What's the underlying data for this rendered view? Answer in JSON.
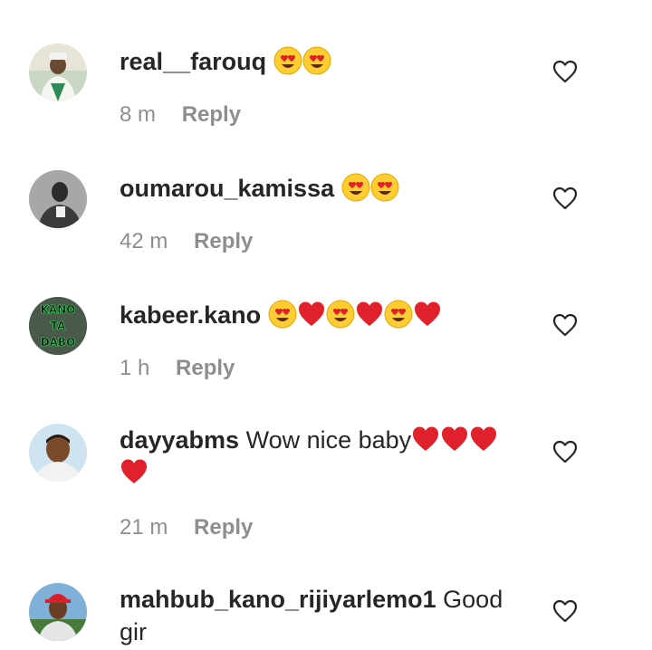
{
  "comments": [
    {
      "username": "real__farouq",
      "text": "",
      "emoji": [
        "heart-eyes",
        "heart-eyes"
      ],
      "time": "8 m",
      "reply_label": "Reply",
      "avatar": "avatar-photo-man-white-cap"
    },
    {
      "username": "oumarou_kamissa",
      "text": "",
      "emoji": [
        "heart-eyes",
        "heart-eyes"
      ],
      "time": "42 m",
      "reply_label": "Reply",
      "avatar": "avatar-photo-man-gray"
    },
    {
      "username": "kabeer.kano",
      "text": "",
      "emoji": [
        "heart-eyes",
        "red-heart",
        "heart-eyes",
        "red-heart",
        "heart-eyes",
        "red-heart"
      ],
      "time": "1 h",
      "reply_label": "Reply",
      "avatar": "avatar-kano-ta-dabo-logo",
      "avatar_text": [
        "KANO",
        "TA",
        "DABO"
      ]
    },
    {
      "username": "dayyabms",
      "text": "Wow nice baby",
      "emoji": [
        "red-heart",
        "red-heart",
        "red-heart",
        "red-heart"
      ],
      "time": "21 m",
      "reply_label": "Reply",
      "avatar": "avatar-photo-man-smiling"
    },
    {
      "username": "mahbub_kano_rijiyarlemo1",
      "text": "Good gir",
      "emoji": [],
      "time": "",
      "reply_label": "",
      "avatar": "avatar-photo-man-red-cap"
    }
  ],
  "colors": {
    "username": "#262626",
    "meta": "#8e8e8e",
    "heart_outline": "#262626",
    "heart_red": "#e0202a",
    "emoji_face": "#ffcc33"
  },
  "icons": {
    "like": "heart-outline-icon"
  }
}
